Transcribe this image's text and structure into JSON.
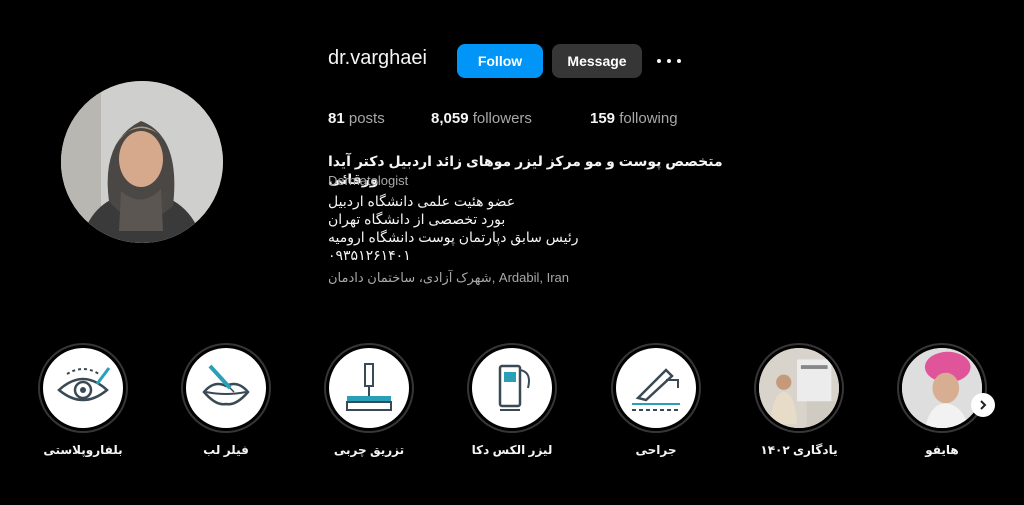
{
  "profile": {
    "username": "dr.varghaei",
    "follow_label": "Follow",
    "message_label": "Message",
    "posts_count": "81",
    "posts_label": "posts",
    "followers_count": "8,059",
    "followers_label": "followers",
    "following_count": "159",
    "following_label": "following"
  },
  "bio": {
    "full_name": "متخصص پوست و مو مرکز لیزر موهای زائد اردبیل دکتر آیدا ورقائی",
    "category": "Dermatologist",
    "lines": [
      "عضو هئیت علمی دانشگاه اردبیل",
      "بورد تخصصی از دانشگاه تهران",
      "رئیس سابق دپارتمان پوست دانشگاه ارومیه",
      "۰۹۳۵۱۲۶۱۴۰۱"
    ],
    "location": "شهرک آزادی، ساختمان دادمان, Ardabil, Iran"
  },
  "highlights": [
    {
      "label": "بلفاروپلاستی",
      "icon": "eye-icon"
    },
    {
      "label": "فیلر لب",
      "icon": "lip-filler-icon"
    },
    {
      "label": "تزریق چربی",
      "icon": "fat-injection-icon"
    },
    {
      "label": "لیزر الکس دکا",
      "icon": "laser-machine-icon"
    },
    {
      "label": "جراحی",
      "icon": "scalpel-icon"
    },
    {
      "label": "یادگاری ۱۴۰۲",
      "icon": "photo-thumbnail"
    },
    {
      "label": "هایفو",
      "icon": "photo-thumbnail"
    }
  ],
  "colors": {
    "background": "#000000",
    "follow_button": "#0095f6",
    "message_button": "#363636",
    "muted_text": "#a8a8a8"
  }
}
